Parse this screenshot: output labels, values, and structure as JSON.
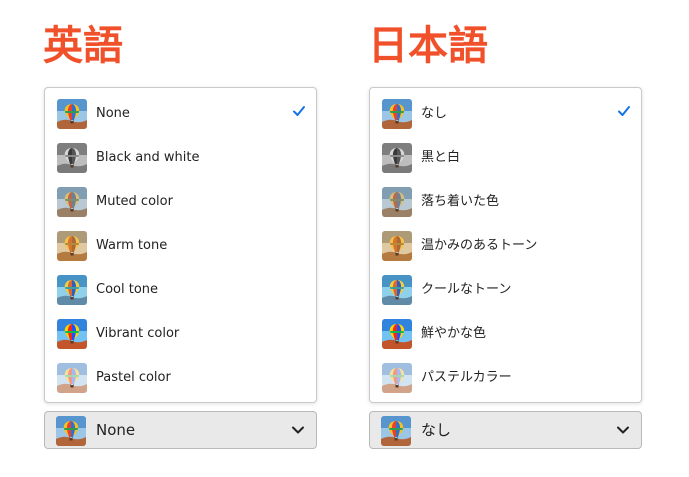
{
  "colors": {
    "heading": "#f0512a",
    "checkmark": "#1473e6",
    "picker_bg": "#e9e9e9",
    "menu_border": "#c9c9c9"
  },
  "english": {
    "heading": "英語",
    "selected_index": 0,
    "items": [
      {
        "label": "None",
        "thumb": "balloon-none"
      },
      {
        "label": "Black and white",
        "thumb": "balloon-bw"
      },
      {
        "label": "Muted color",
        "thumb": "balloon-muted"
      },
      {
        "label": "Warm tone",
        "thumb": "balloon-warm"
      },
      {
        "label": "Cool tone",
        "thumb": "balloon-cool"
      },
      {
        "label": "Vibrant color",
        "thumb": "balloon-vibrant"
      },
      {
        "label": "Pastel color",
        "thumb": "balloon-pastel"
      }
    ],
    "picker": {
      "value": "None",
      "icon": "chevron-down-icon"
    }
  },
  "japanese": {
    "heading": "日本語",
    "selected_index": 0,
    "items": [
      {
        "label": "なし",
        "thumb": "balloon-none"
      },
      {
        "label": "黒と白",
        "thumb": "balloon-bw"
      },
      {
        "label": "落ち着いた色",
        "thumb": "balloon-muted"
      },
      {
        "label": "温かみのあるトーン",
        "thumb": "balloon-warm"
      },
      {
        "label": "クールなトーン",
        "thumb": "balloon-cool"
      },
      {
        "label": "鮮やかな色",
        "thumb": "balloon-vibrant"
      },
      {
        "label": "パステルカラー",
        "thumb": "balloon-pastel"
      }
    ],
    "picker": {
      "value": "なし",
      "icon": "chevron-down-icon"
    }
  }
}
